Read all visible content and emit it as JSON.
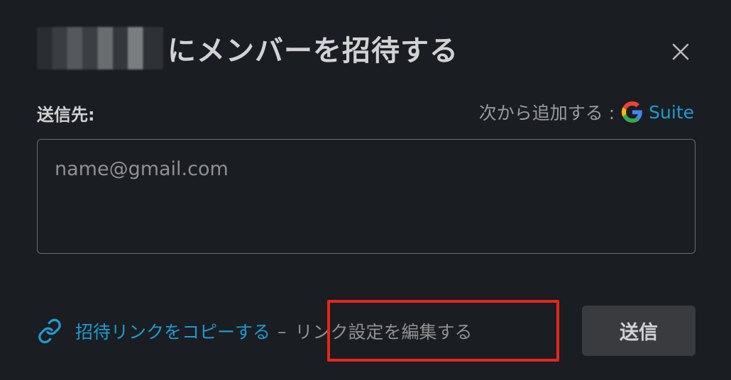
{
  "dialog": {
    "title_suffix": "にメンバーを招待する",
    "close_icon": "close-icon"
  },
  "recipients": {
    "label": "送信先:",
    "add_from_label": "次から追加する :",
    "provider_icon": "google-g-icon",
    "provider_link": "Suite",
    "input_placeholder": "name@gmail.com",
    "input_value": ""
  },
  "footer": {
    "link_icon": "link-icon",
    "copy_link_label": "招待リンクをコピーする",
    "separator": "–",
    "edit_settings_label": "リンク設定を編集する",
    "send_label": "送信"
  },
  "colors": {
    "background": "#1a1d21",
    "text": "#d1d2d3",
    "muted": "#8f9092",
    "link": "#1d9bd1",
    "button": "#3a3b3e",
    "highlight": "#e8261b"
  }
}
